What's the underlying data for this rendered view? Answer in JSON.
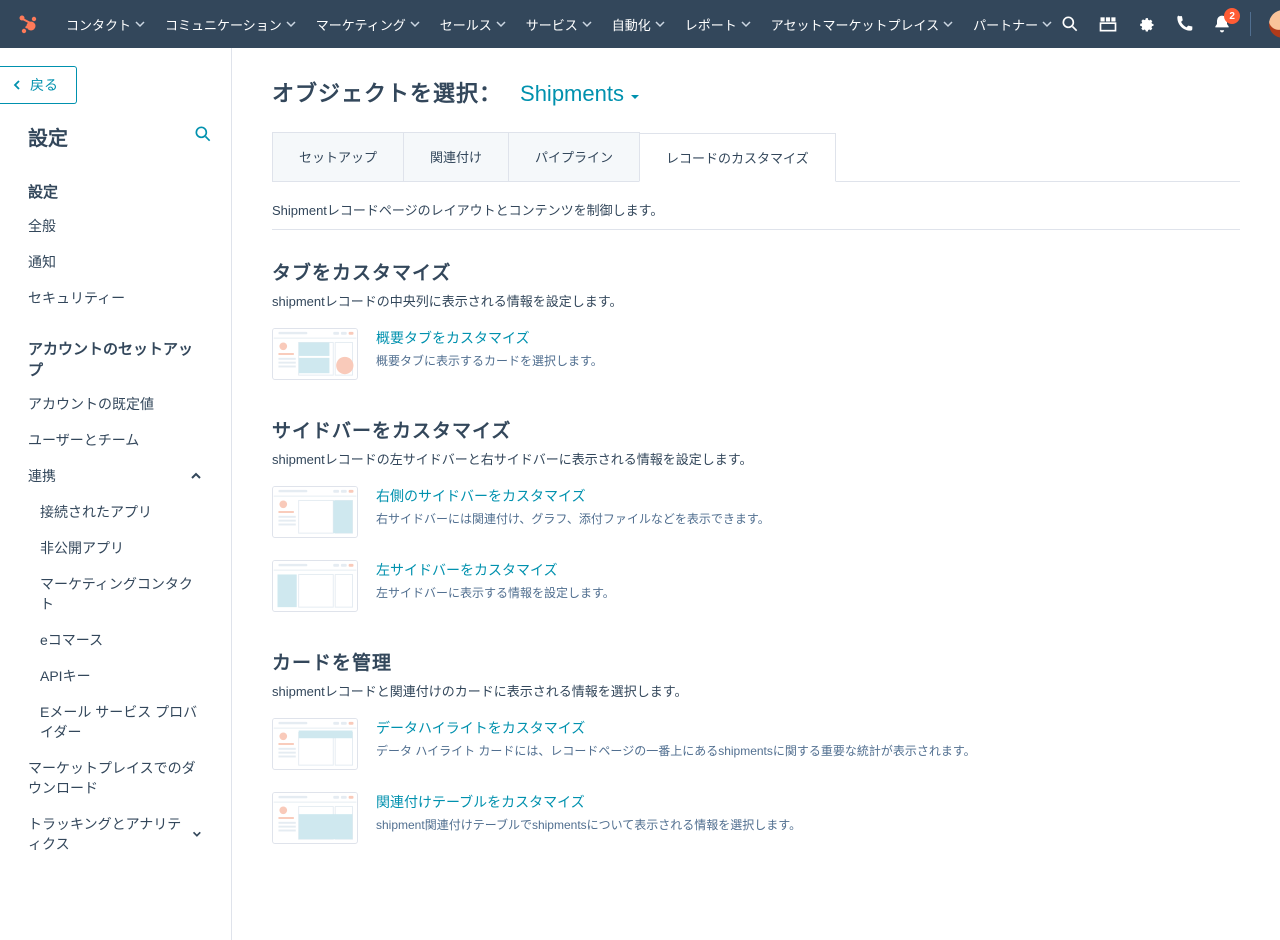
{
  "nav": {
    "items": [
      "コンタクト",
      "コミュニケーション",
      "マーケティング",
      "セールス",
      "サービス",
      "自動化",
      "レポート",
      "アセットマーケットプレイス",
      "パートナー"
    ],
    "badge_count": "2"
  },
  "back_label": "戻る",
  "sidebar": {
    "title": "設定",
    "section1_title": "設定",
    "general": "全般",
    "notifications": "通知",
    "security": "セキュリティー",
    "section2_title": "アカウントのセットアップ",
    "acct_defaults": "アカウントの既定値",
    "users_teams": "ユーザーとチーム",
    "integrations": "連携",
    "connected_apps": "接続されたアプリ",
    "private_apps": "非公開アプリ",
    "marketing_contacts": "マーケティングコンタクト",
    "ecommerce": "eコマース",
    "api_key": "APIキー",
    "email_provider": "Eメール サービス プロバイダー",
    "marketplace_dl": "マーケットプレイスでのダウンロード",
    "tracking": "トラッキングとアナリティクス"
  },
  "main": {
    "select_label": "オブジェクトを選択：",
    "object_name": "Shipments",
    "tabs": [
      "セットアップ",
      "関連付け",
      "パイプライン",
      "レコードのカスタマイズ"
    ],
    "active_tab": 3,
    "subtext": "Shipmentレコードページのレイアウトとコンテンツを制御します。",
    "sections": [
      {
        "title": "タブをカスタマイズ",
        "desc": "shipmentレコードの中央列に表示される情報を設定します。",
        "cards": [
          {
            "link": "概要タブをカスタマイズ",
            "desc": "概要タブに表示するカードを選択します。",
            "thumb": "center"
          }
        ]
      },
      {
        "title": "サイドバーをカスタマイズ",
        "desc": "shipmentレコードの左サイドバーと右サイドバーに表示される情報を設定します。",
        "cards": [
          {
            "link": "右側のサイドバーをカスタマイズ",
            "desc": "右サイドバーには関連付け、グラフ、添付ファイルなどを表示できます。",
            "thumb": "right"
          },
          {
            "link": "左サイドバーをカスタマイズ",
            "desc": "左サイドバーに表示する情報を設定します。",
            "thumb": "left"
          }
        ]
      },
      {
        "title": "カードを管理",
        "desc": "shipmentレコードと関連付けのカードに表示される情報を選択します。",
        "cards": [
          {
            "link": "データハイライトをカスタマイズ",
            "desc": "データ ハイライト カードには、レコードページの一番上にあるshipmentsに関する重要な統計が表示されます。",
            "thumb": "top"
          },
          {
            "link": "関連付けテーブルをカスタマイズ",
            "desc": "shipment関連付けテーブルでshipmentsについて表示される情報を選択します。",
            "thumb": "table"
          }
        ]
      }
    ]
  }
}
